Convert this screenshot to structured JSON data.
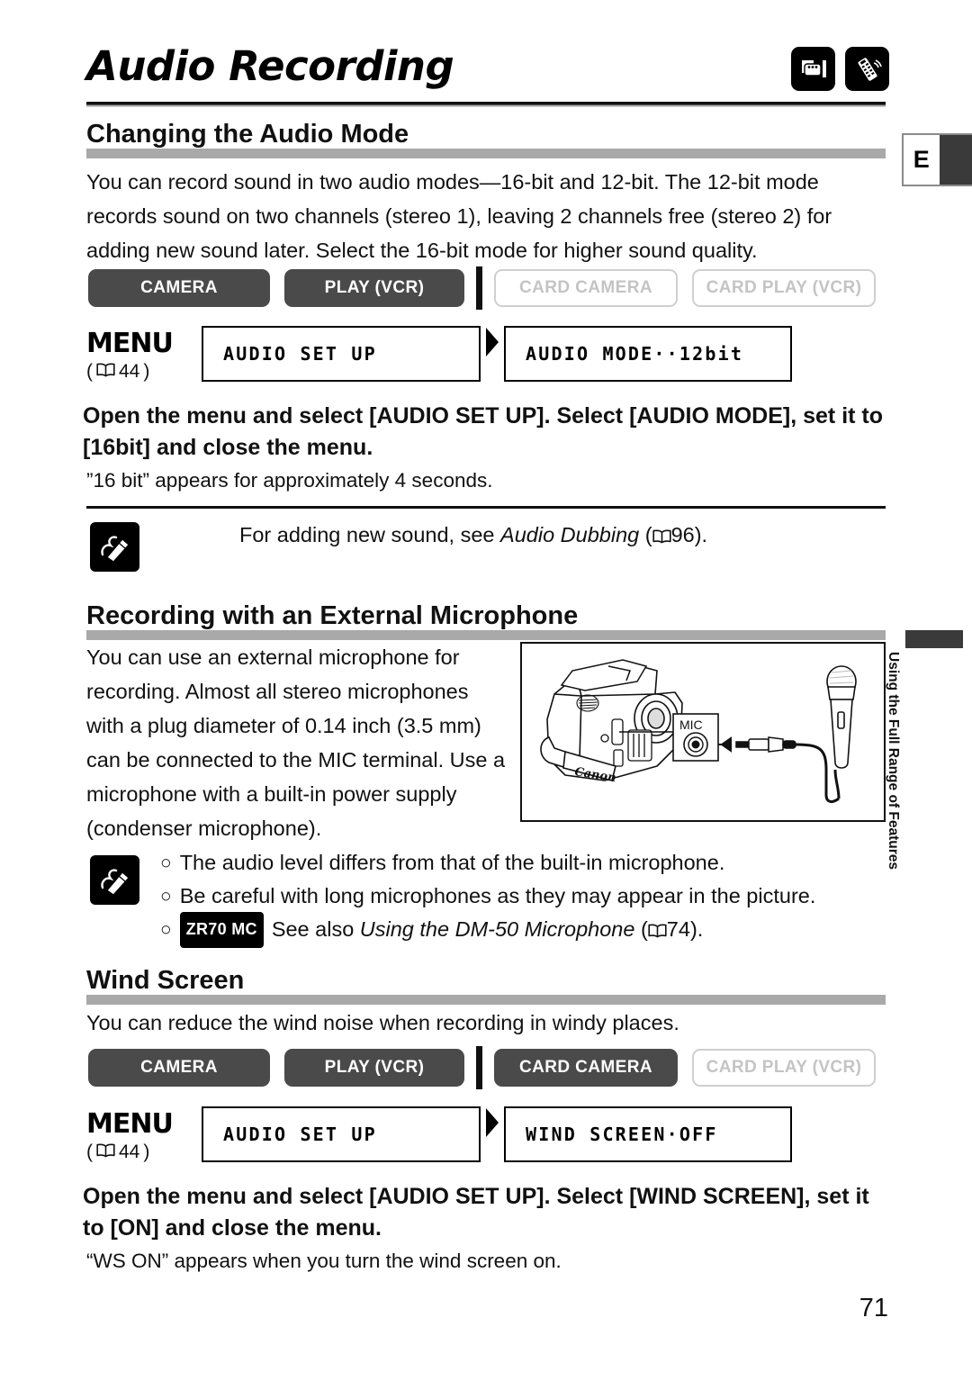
{
  "document": {
    "title": "Audio Recording",
    "page_number": "71",
    "language_tab": "E",
    "side_tab": "Using the Full Range of Features",
    "header_icons": [
      "camcorder-tape-icon",
      "remote-control-icon"
    ]
  },
  "sections": [
    {
      "heading": "Changing the Audio Mode",
      "body": "You can record sound in two audio modes—16-bit and 12-bit. The 12-bit mode records sound on two channels (stereo 1), leaving 2 channels free (stereo 2) for adding new sound later. Select the 16-bit mode for higher sound quality.",
      "modes": [
        {
          "label": "CAMERA",
          "active": true
        },
        {
          "label": "PLAY (VCR)",
          "active": true
        },
        {
          "label": "CARD CAMERA",
          "active": false
        },
        {
          "label": "CARD PLAY (VCR)",
          "active": false
        }
      ],
      "menu": {
        "label": "MENU",
        "page_ref": "44",
        "box1": "AUDIO SET UP",
        "box2": "AUDIO MODE··12bit"
      },
      "instruction": "Open the menu and select [AUDIO SET UP]. Select [AUDIO MODE], set it to [16bit] and close the menu.",
      "subtext": "”16 bit” appears for approximately 4 seconds.",
      "note": {
        "icon": "memo-pencil-icon",
        "text_pre": "For adding new sound, see ",
        "text_italic": "Audio Dubbing",
        "text_post": " (  96)."
      }
    },
    {
      "heading": "Recording with an External Microphone",
      "body": "You can use an external microphone for recording. Almost all stereo microphones with a plug diameter of 0.14 inch (3.5 mm) can be connected to the MIC terminal. Use a microphone with a built-in power supply (condenser microphone).",
      "figure": {
        "name": "camcorder-microphone-connection-diagram",
        "brand": "Canon",
        "terminal_label": "MIC"
      },
      "notes": {
        "icon": "memo-pencil-icon",
        "bullets": [
          {
            "marker": "○",
            "badge": "",
            "text": "The audio level differs from that of the built-in microphone.",
            "italic": "",
            "tail": ""
          },
          {
            "marker": "○",
            "badge": "",
            "text": "Be careful with long microphones as they may appear in the picture.",
            "italic": "",
            "tail": ""
          },
          {
            "marker": "○",
            "badge": "ZR70 MC",
            "text": " See also ",
            "italic": "Using the DM-50 Microphone",
            "tail": " (  74)."
          }
        ]
      }
    },
    {
      "heading": "Wind Screen",
      "body": "You can reduce the wind noise when recording in windy places.",
      "modes": [
        {
          "label": "CAMERA",
          "active": true
        },
        {
          "label": "PLAY (VCR)",
          "active": true
        },
        {
          "label": "CARD CAMERA",
          "active": true
        },
        {
          "label": "CARD PLAY (VCR)",
          "active": false
        }
      ],
      "menu": {
        "label": "MENU",
        "page_ref": "44",
        "box1": "AUDIO SET UP",
        "box2": "WIND SCREEN·OFF"
      },
      "instruction": "Open the menu and select [AUDIO SET UP]. Select [WIND SCREEN], set it to [ON] and close the menu.",
      "subtext": "“WS ON” appears when you turn the wind screen on."
    }
  ],
  "page_refs": {
    "dubbing": "96",
    "dm50": "74",
    "menu": "44"
  }
}
